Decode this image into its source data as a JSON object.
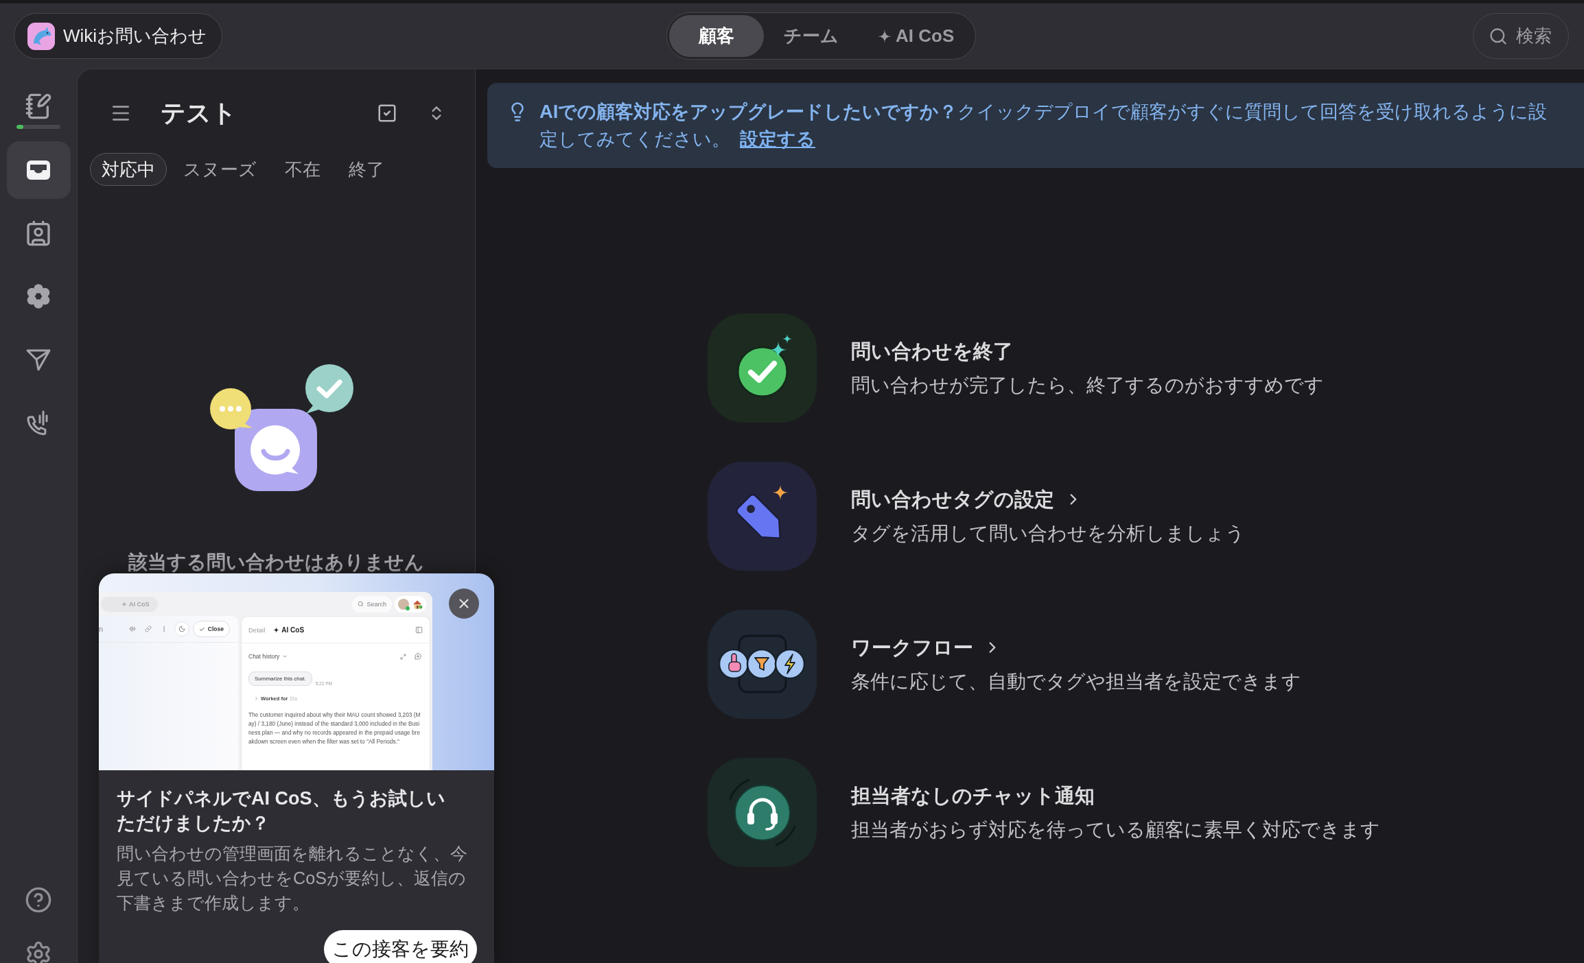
{
  "top_bar": {
    "workspace": {
      "name": "Wikiお問い合わせ"
    },
    "tabs": [
      {
        "label": "顧客",
        "kind": "plain",
        "selected": true
      },
      {
        "label": "チーム",
        "kind": "plain",
        "selected": false
      },
      {
        "label": "AI CoS",
        "kind": "ai",
        "selected": false
      }
    ],
    "search": {
      "label": "検索"
    }
  },
  "sidebar": {
    "items": [
      {
        "kind": "compose",
        "selected": false,
        "level": 0.15
      },
      {
        "kind": "inbox",
        "selected": true
      },
      {
        "kind": "contacts",
        "selected": false
      },
      {
        "kind": "apps",
        "selected": false
      },
      {
        "kind": "campaigns",
        "selected": false
      },
      {
        "kind": "calls",
        "selected": false
      }
    ],
    "bottom_items": [
      {
        "kind": "help"
      },
      {
        "kind": "settings"
      }
    ]
  },
  "inbox_panel": {
    "title": "テスト",
    "tabs": [
      {
        "label": "対応中",
        "selected": true
      },
      {
        "label": "スヌーズ",
        "selected": false
      },
      {
        "label": "不在",
        "selected": false
      },
      {
        "label": "終了",
        "selected": false
      }
    ],
    "empty_message": "該当する問い合わせはありません"
  },
  "banner": {
    "text": "**AIでの顧客対応をアップグレードしたいですか？**クイックデプロイで顧客がすぐに質問して回答を受け取れるように設定してみてください。",
    "link": "設定する"
  },
  "features": [
    {
      "kind": "close",
      "title": "問い合わせを終了",
      "description": "問い合わせが完了したら、終了するのがおすすめです",
      "chevron": false
    },
    {
      "kind": "tag",
      "title": "問い合わせタグの設定",
      "description": "タグを活用して問い合わせを分析しましょう",
      "chevron": true
    },
    {
      "kind": "workflow",
      "title": "ワークフロー",
      "description": "条件に応じて、自動でタグや担当者を設定できます",
      "chevron": true
    },
    {
      "kind": "notify",
      "title": "担当者なしのチャット通知",
      "description": "担当者がおらず対応を待っている顧客に素早く対応できます",
      "chevron": false
    }
  ],
  "promo_card": {
    "preview": {
      "top_tab": "AI CoS",
      "search": "Search",
      "toolbar_text": "n",
      "close_button": "Close",
      "panel_tabs": [
        {
          "label": "Detail",
          "kind": "plain",
          "selected": false
        },
        {
          "label": "AI CoS",
          "kind": "ai",
          "selected": true
        }
      ],
      "history": "Chat history",
      "message": "Summarize this chat.",
      "time": "5:22 PM",
      "worked": "Worked for",
      "duration": "21s",
      "summary": "The customer inquired about why their MAU count showed 3,203 (May) / 3,180 (June) instead of the standard 3,000 included in the Business plan — and why no records appeared in the prepaid usage breakdown screen even when the filter was set to \"All Periods.\""
    },
    "title": "サイドパネルでAI CoS、もうお試しいただけましたか？",
    "body": "問い合わせの管理画面を離れることなく、今見ている問い合わせをCoSが要約し、返信の下書きまで作成します。",
    "button": "この接客を要約"
  }
}
